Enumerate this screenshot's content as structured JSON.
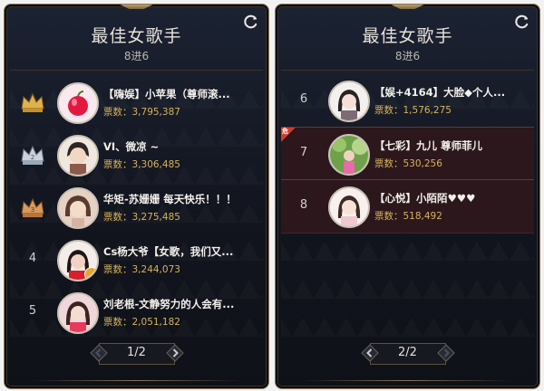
{
  "left_panel": {
    "title": "最佳女歌手",
    "subtitle": "8进6",
    "pager": "1/2",
    "entries": [
      {
        "rank": "1",
        "name": "【嗨娱】小苹果（尊师滚...",
        "votes": "票数：3,795,387",
        "badge": "crown-gold"
      },
      {
        "rank": "2",
        "name": "VI、微凉 ~",
        "votes": "票数：3,306,485",
        "badge": "crown-silver"
      },
      {
        "rank": "3",
        "name": "华矩-苏姗姗 每天快乐！！！",
        "votes": "票数：3,275,485",
        "badge": "crown-bronze"
      },
      {
        "rank": "4",
        "name": "Cs杨大爷【女歌，我们又...",
        "votes": "票数：3,244,073",
        "badge": ""
      },
      {
        "rank": "5",
        "name": "刘老根-文静努力的人会有...",
        "votes": "票数：2,051,182",
        "badge": ""
      }
    ]
  },
  "right_panel": {
    "title": "最佳女歌手",
    "subtitle": "8进6",
    "pager": "2/2",
    "entries": [
      {
        "rank": "6",
        "name": "【娱+4164】大脸◆个人...",
        "votes": "票数：1,576,275"
      },
      {
        "rank": "7",
        "name": "【七彩】九儿 尊师菲儿",
        "votes": "票数：530,256",
        "corner_badge": "危"
      },
      {
        "rank": "8",
        "name": "【心悦】小陌陌♥♥♥",
        "votes": "票数：518,492"
      }
    ]
  },
  "colors": {
    "gold": "#e0b24d",
    "silver": "#c9d2dd",
    "bronze": "#d79a5b",
    "votes": "#d6b35d",
    "highlight_row": "#2b171c"
  },
  "icons": {
    "refresh": "refresh-icon",
    "prev": "chevron-left-icon",
    "next": "chevron-right-icon",
    "crown": "crown-icon"
  }
}
